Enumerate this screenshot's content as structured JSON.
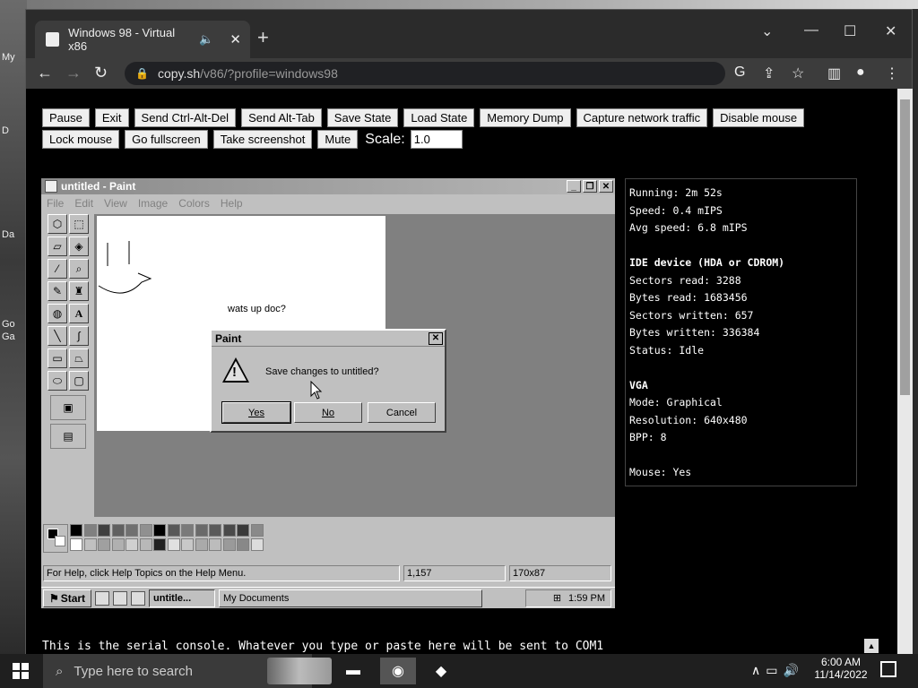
{
  "desktop": {
    "labels": [
      "My",
      "D",
      "Da",
      "Go",
      "Ga"
    ]
  },
  "browser": {
    "tab_title": "Windows 98 - Virtual x86",
    "url_host": "copy.sh",
    "url_path": "/v86/?profile=windows98"
  },
  "controls": {
    "row1": [
      "Pause",
      "Exit",
      "Send Ctrl-Alt-Del",
      "Send Alt-Tab",
      "Save State",
      "Load State",
      "Memory Dump",
      "Capture network traffic",
      "Disable mouse"
    ],
    "row2": [
      "Lock mouse",
      "Go fullscreen",
      "Take screenshot",
      "Mute"
    ],
    "scale_label": "Scale:",
    "scale_value": "1.0"
  },
  "paint": {
    "title": "untitled - Paint",
    "menu": [
      "File",
      "Edit",
      "View",
      "Image",
      "Colors",
      "Help"
    ],
    "canvas_text": "wats up doc?",
    "status_help": "For Help, click Help Topics on the Help Menu.",
    "status_coords": "1,157",
    "status_size": "170x87"
  },
  "dialog": {
    "title": "Paint",
    "message": "Save changes to untitled?",
    "yes": "Yes",
    "no": "No",
    "cancel": "Cancel"
  },
  "w98_taskbar": {
    "start": "Start",
    "task1": "untitle...",
    "task2": "My Documents",
    "clock": "1:59 PM"
  },
  "stats": {
    "running": "Running: 2m 52s",
    "speed": "Speed: 0.4 mIPS",
    "avg_speed": "Avg speed: 6.8 mIPS",
    "ide_header": "IDE device (HDA or CDROM)",
    "sectors_read": "Sectors read: 3288",
    "bytes_read": "Bytes read: 1683456",
    "sectors_written": "Sectors written: 657",
    "bytes_written": "Bytes written: 336384",
    "status": "Status: Idle",
    "vga_header": "VGA",
    "mode": "Mode: Graphical",
    "resolution": "Resolution: 640x480",
    "bpp": "BPP: 8",
    "mouse": "Mouse: Yes"
  },
  "serial": {
    "text": "This is the serial console. Whatever you type or paste here will be sent to COM1"
  },
  "os_taskbar": {
    "search_placeholder": "Type here to search",
    "time": "6:00 AM",
    "date": "11/14/2022"
  }
}
